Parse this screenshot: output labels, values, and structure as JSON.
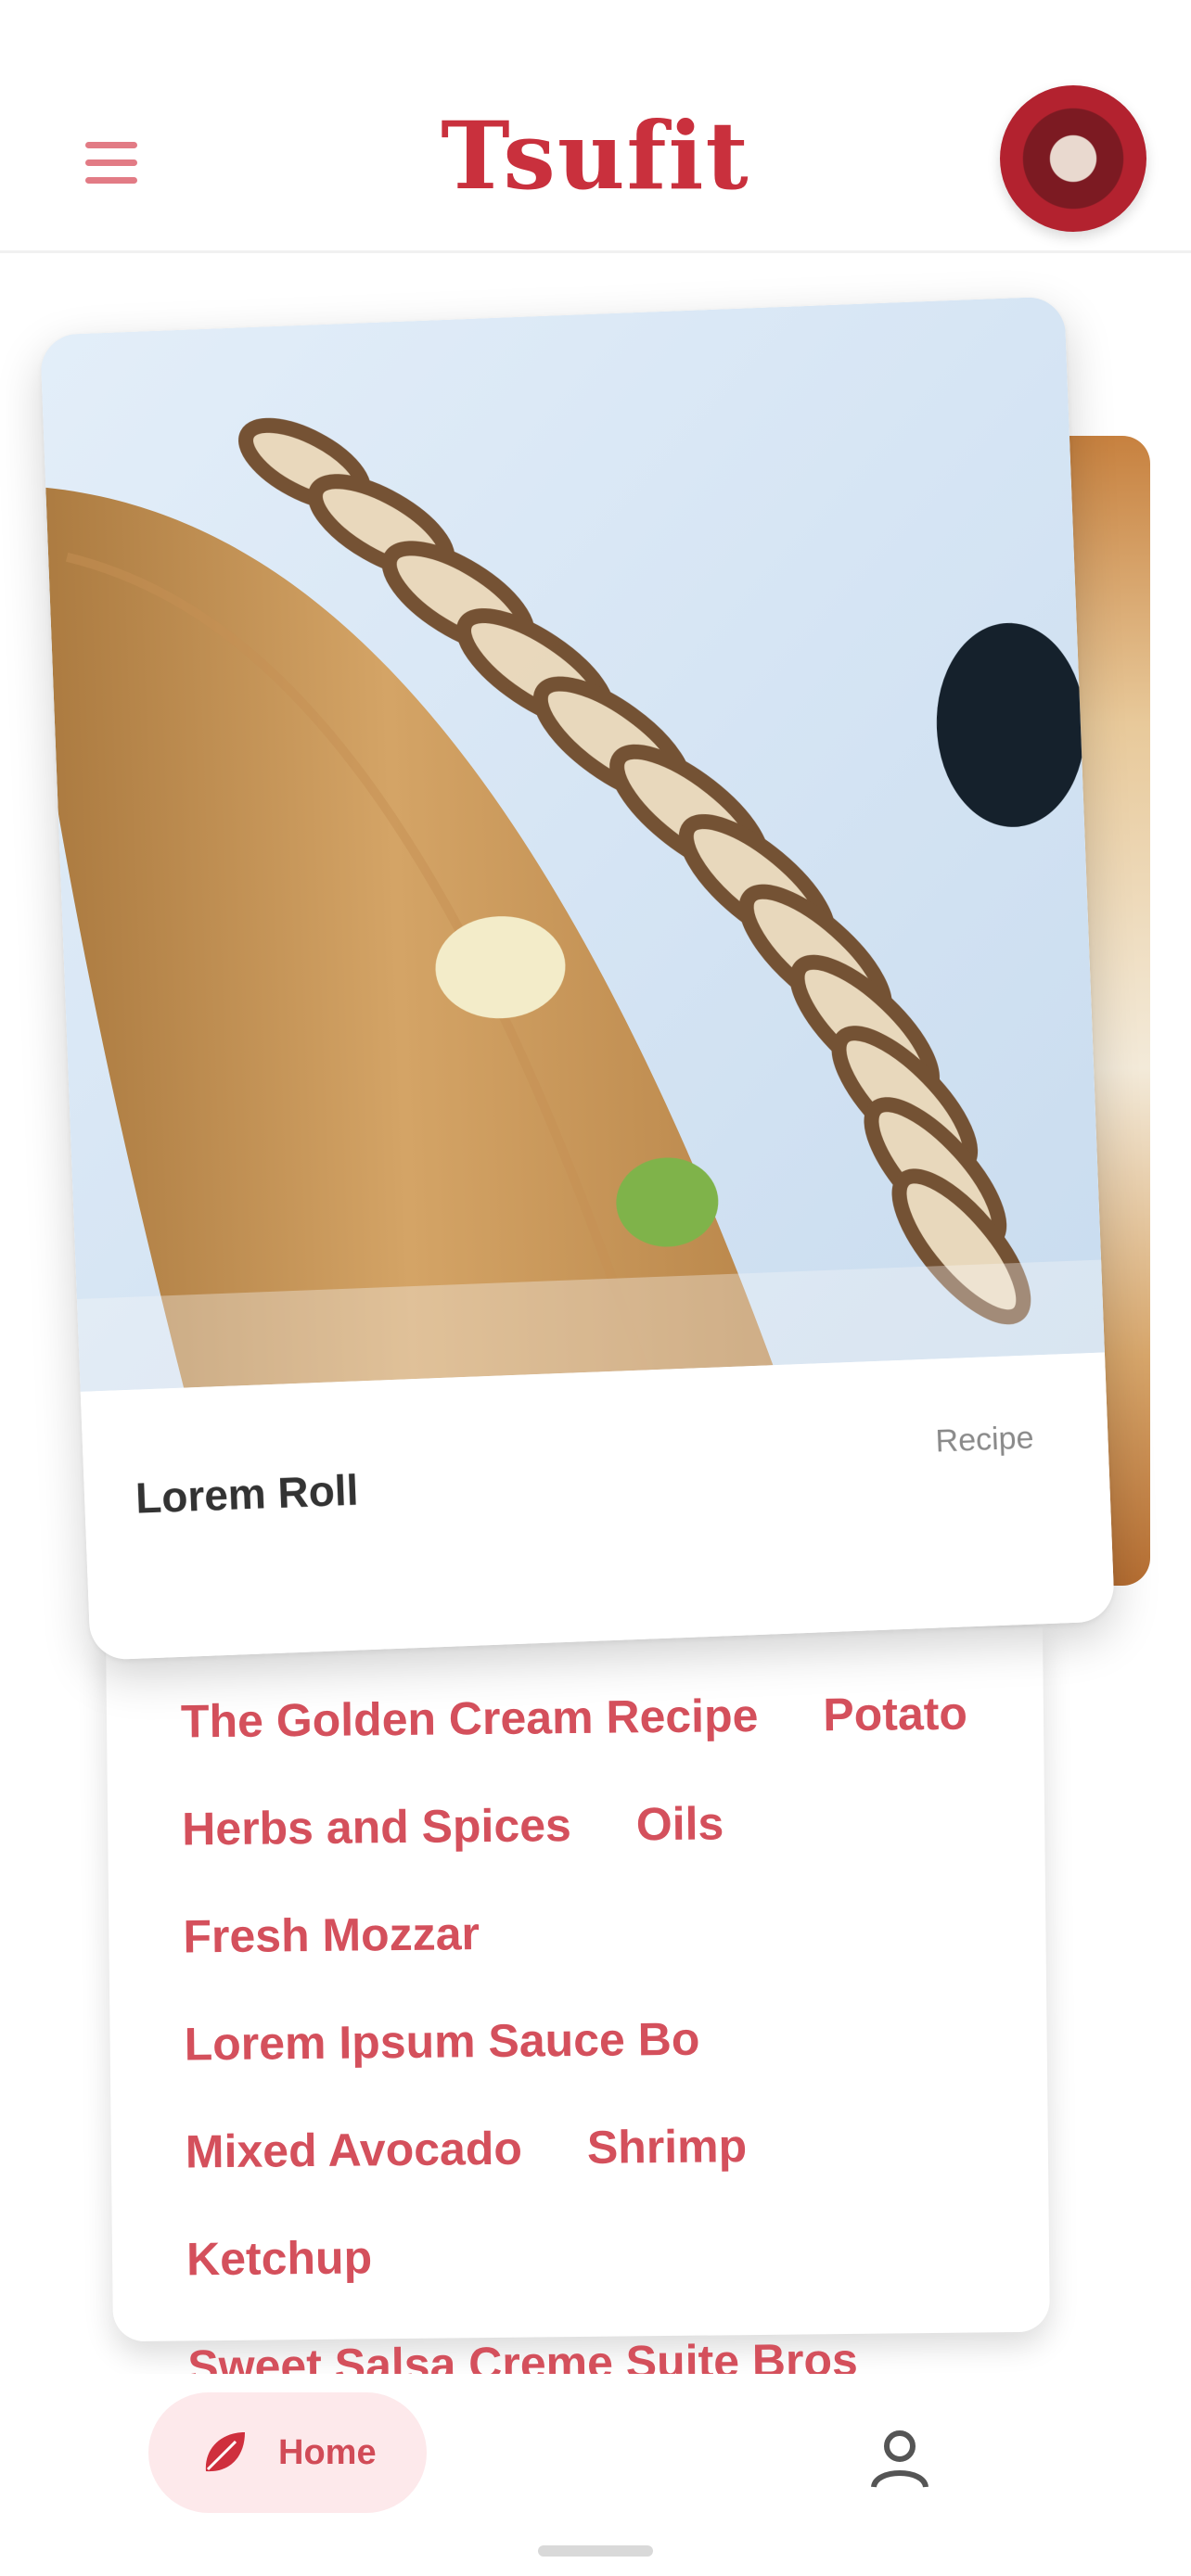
{
  "header": {
    "brand_title": "Tsufit"
  },
  "card": {
    "recipe_name": "Lorem Roll",
    "recipe_meta": "Recipe"
  },
  "ingredients": [
    "The Golden Cream Recipe",
    "Potato",
    "Herbs and Spices",
    "Oils",
    "Fresh Mozzar",
    "Lorem Ipsum Sauce Bo",
    "Mixed Avocado",
    "Shrimp",
    "Ketchup",
    "Sweet Salsa Creme Suite Bros"
  ],
  "nav": {
    "home_label": "Home"
  },
  "colors": {
    "brand": "#c9303d",
    "tag": "#d4505c",
    "nav_pill": "#fde9eb"
  }
}
